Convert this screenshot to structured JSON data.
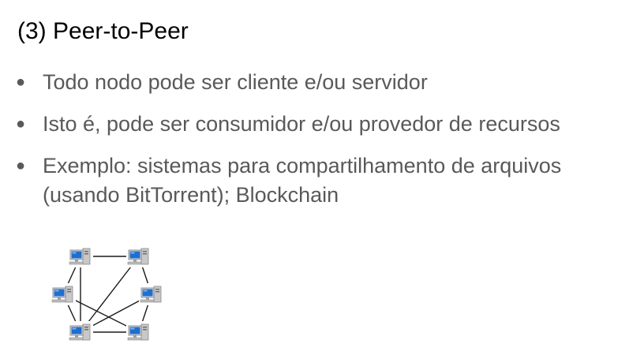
{
  "slide": {
    "title": "(3) Peer-to-Peer",
    "bullets": [
      "Todo nodo pode ser cliente e/ou servidor",
      "Isto é, pode ser consumidor e/ou provedor de recursos",
      "Exemplo: sistemas para compartilhamento de arquivos (usando BitTorrent); Blockchain"
    ],
    "bullet_glyph": "●"
  },
  "diagram": {
    "node_icon": "desktop-computer-icon",
    "nodes": [
      "top-left",
      "top-right",
      "middle-left",
      "middle-right",
      "bottom-left",
      "bottom-right"
    ],
    "links": [
      [
        "top-left",
        "top-right"
      ],
      [
        "top-left",
        "middle-left"
      ],
      [
        "top-right",
        "middle-right"
      ],
      [
        "middle-left",
        "bottom-left"
      ],
      [
        "middle-right",
        "bottom-right"
      ],
      [
        "bottom-left",
        "bottom-right"
      ],
      [
        "top-left",
        "bottom-left"
      ],
      [
        "top-right",
        "bottom-left"
      ],
      [
        "middle-left",
        "bottom-right"
      ],
      [
        "middle-right",
        "bottom-left"
      ]
    ],
    "colors": {
      "screen": "#1e6fd0",
      "tower": "#c8c8c8",
      "link": "#1a1a1a"
    }
  }
}
